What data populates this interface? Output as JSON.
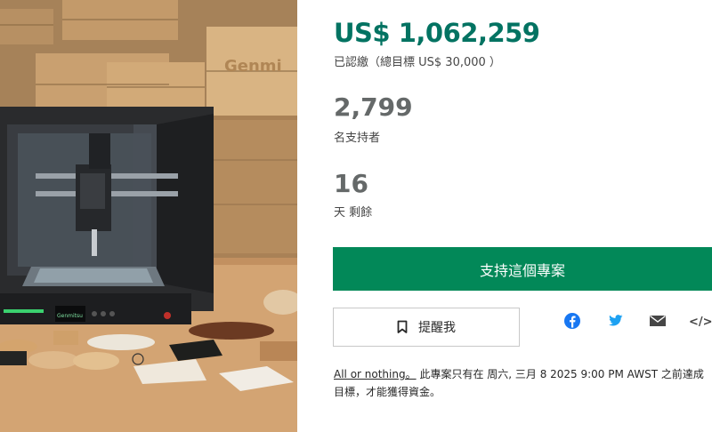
{
  "campaign": {
    "pledged_amount": "US$ 1,062,259",
    "pledged_note": "已認繳（總目標 US$ 30,000 ）",
    "backers_count": "2,799",
    "backers_label": "名支持者",
    "days_left": "16",
    "days_label": "天 剩餘"
  },
  "media": {
    "brand_text": "Genmi",
    "printer_screen_text": "Genmitsu"
  },
  "actions": {
    "back_label": "支持這個專案",
    "remind_label": "提醒我"
  },
  "share": {
    "icons": [
      "facebook-icon",
      "twitter-icon",
      "email-icon",
      "embed-icon"
    ],
    "embed_glyph": "</>"
  },
  "terms": {
    "link_text": "All or nothing。",
    "text": "此專案只有在 周六, 三月 8 2025 9:00 PM AWST 之前達成目標，才能獲得資金。"
  },
  "colors": {
    "accent_green": "#037362",
    "button_green": "#028858",
    "facebook": "#1877f2",
    "twitter": "#1da1f2"
  }
}
